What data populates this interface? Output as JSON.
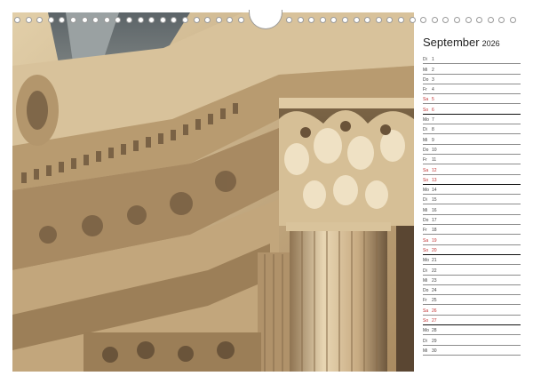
{
  "calendar": {
    "month": "September",
    "year": "2026",
    "days": [
      {
        "wd": "Di",
        "d": "1",
        "we": false
      },
      {
        "wd": "Mi",
        "d": "2",
        "we": false
      },
      {
        "wd": "Do",
        "d": "3",
        "we": false
      },
      {
        "wd": "Fr",
        "d": "4",
        "we": false
      },
      {
        "wd": "Sa",
        "d": "5",
        "we": true
      },
      {
        "wd": "So",
        "d": "6",
        "we": true
      },
      {
        "wd": "Mo",
        "d": "7",
        "we": false
      },
      {
        "wd": "Di",
        "d": "8",
        "we": false
      },
      {
        "wd": "Mi",
        "d": "9",
        "we": false
      },
      {
        "wd": "Do",
        "d": "10",
        "we": false
      },
      {
        "wd": "Fr",
        "d": "11",
        "we": false
      },
      {
        "wd": "Sa",
        "d": "12",
        "we": true
      },
      {
        "wd": "So",
        "d": "13",
        "we": true
      },
      {
        "wd": "Mo",
        "d": "14",
        "we": false
      },
      {
        "wd": "Di",
        "d": "15",
        "we": false
      },
      {
        "wd": "Mi",
        "d": "16",
        "we": false
      },
      {
        "wd": "Do",
        "d": "17",
        "we": false
      },
      {
        "wd": "Fr",
        "d": "18",
        "we": false
      },
      {
        "wd": "Sa",
        "d": "19",
        "we": true
      },
      {
        "wd": "So",
        "d": "20",
        "we": true
      },
      {
        "wd": "Mo",
        "d": "21",
        "we": false
      },
      {
        "wd": "Di",
        "d": "22",
        "we": false
      },
      {
        "wd": "Mi",
        "d": "23",
        "we": false
      },
      {
        "wd": "Do",
        "d": "24",
        "we": false
      },
      {
        "wd": "Fr",
        "d": "25",
        "we": false
      },
      {
        "wd": "Sa",
        "d": "26",
        "we": true
      },
      {
        "wd": "So",
        "d": "27",
        "we": true
      },
      {
        "wd": "Mo",
        "d": "28",
        "we": false
      },
      {
        "wd": "Di",
        "d": "29",
        "we": false
      },
      {
        "wd": "Mi",
        "d": "30",
        "we": false
      }
    ]
  },
  "colors": {
    "weekend": "#c03030",
    "weekday": "#444444",
    "stone": "#c9b38f"
  }
}
